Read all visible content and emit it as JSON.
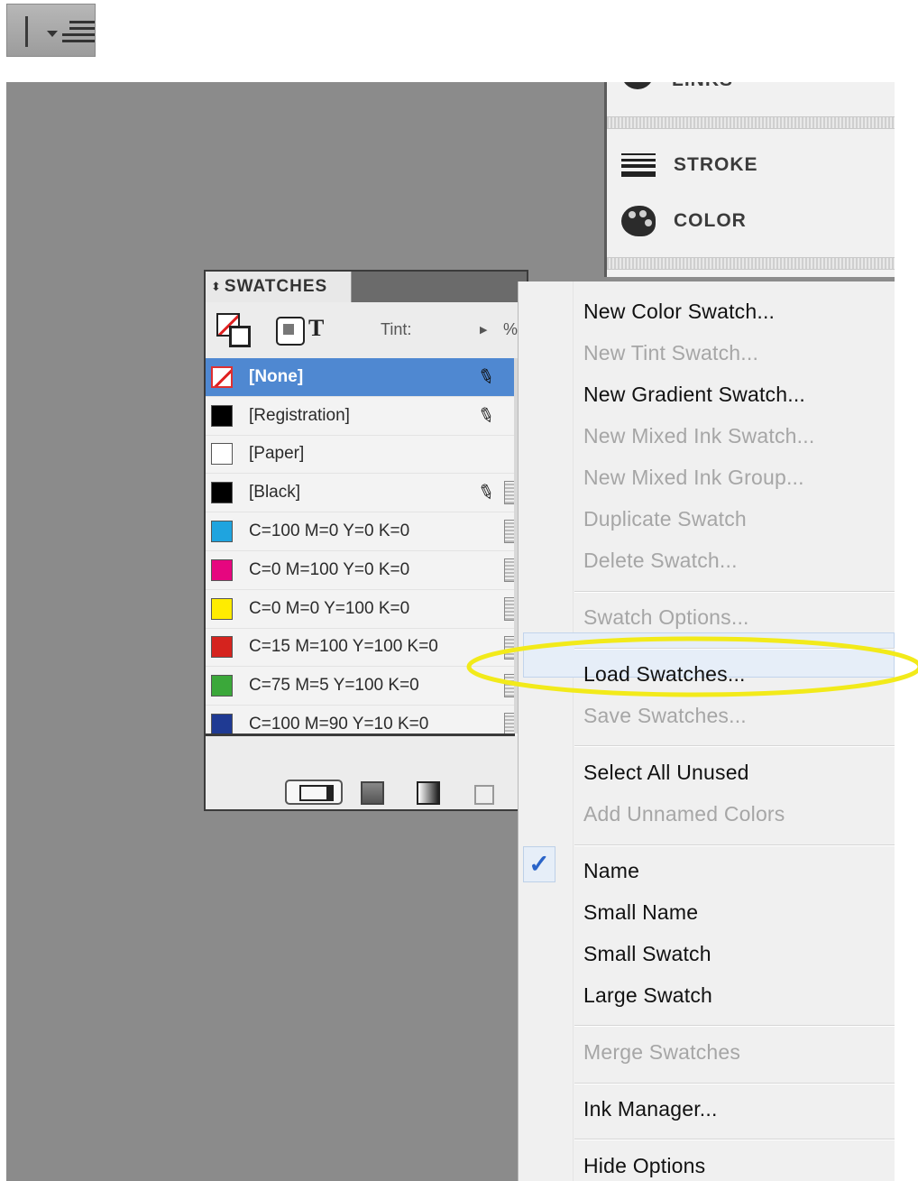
{
  "toolbar": {
    "menu_button_icon": "panel-menu-icon"
  },
  "dock": {
    "items": [
      {
        "label": "LINKS",
        "icon": "links-icon"
      },
      {
        "label": "STROKE",
        "icon": "stroke-icon"
      },
      {
        "label": "COLOR",
        "icon": "color-icon"
      }
    ]
  },
  "swatches": {
    "title": "SWATCHES",
    "tint_label": "Tint:",
    "tint_unit": "%",
    "items": [
      {
        "name": "[None]",
        "color": "none",
        "selected": true
      },
      {
        "name": "[Registration]",
        "color": "#000000"
      },
      {
        "name": "[Paper]",
        "color": "#ffffff"
      },
      {
        "name": "[Black]",
        "color": "#000000"
      },
      {
        "name": "C=100 M=0 Y=0 K=0",
        "color": "#1fa4df"
      },
      {
        "name": "C=0 M=100 Y=0 K=0",
        "color": "#e6067f"
      },
      {
        "name": "C=0 M=0 Y=100 K=0",
        "color": "#ffec00"
      },
      {
        "name": "C=15 M=100 Y=100 K=0",
        "color": "#d5231e"
      },
      {
        "name": "C=75 M=5 Y=100 K=0",
        "color": "#3ba83a"
      },
      {
        "name": "C=100 M=90 Y=10 K=0",
        "color": "#1f3a93"
      }
    ]
  },
  "menu": {
    "items": [
      {
        "label": "New Color Swatch...",
        "enabled": true
      },
      {
        "label": "New Tint Swatch...",
        "enabled": false
      },
      {
        "label": "New Gradient Swatch...",
        "enabled": true
      },
      {
        "label": "New Mixed Ink Swatch...",
        "enabled": false
      },
      {
        "label": "New Mixed Ink Group...",
        "enabled": false
      },
      {
        "label": "Duplicate Swatch",
        "enabled": false
      },
      {
        "label": "Delete Swatch...",
        "enabled": false
      },
      {
        "label": "Swatch Options...",
        "enabled": false
      },
      {
        "label": "Load Swatches...",
        "enabled": true,
        "highlighted": true
      },
      {
        "label": "Save Swatches...",
        "enabled": false
      },
      {
        "label": "Select All Unused",
        "enabled": true
      },
      {
        "label": "Add Unnamed Colors",
        "enabled": false
      },
      {
        "label": "Name",
        "enabled": true,
        "checked": true
      },
      {
        "label": "Small Name",
        "enabled": true
      },
      {
        "label": "Small Swatch",
        "enabled": true
      },
      {
        "label": "Large Swatch",
        "enabled": true
      },
      {
        "label": "Merge Swatches",
        "enabled": false
      },
      {
        "label": "Ink Manager...",
        "enabled": true
      },
      {
        "label": "Hide Options",
        "enabled": true
      }
    ],
    "check_mark": "✓"
  },
  "annotation_color": "#f2ea1a"
}
